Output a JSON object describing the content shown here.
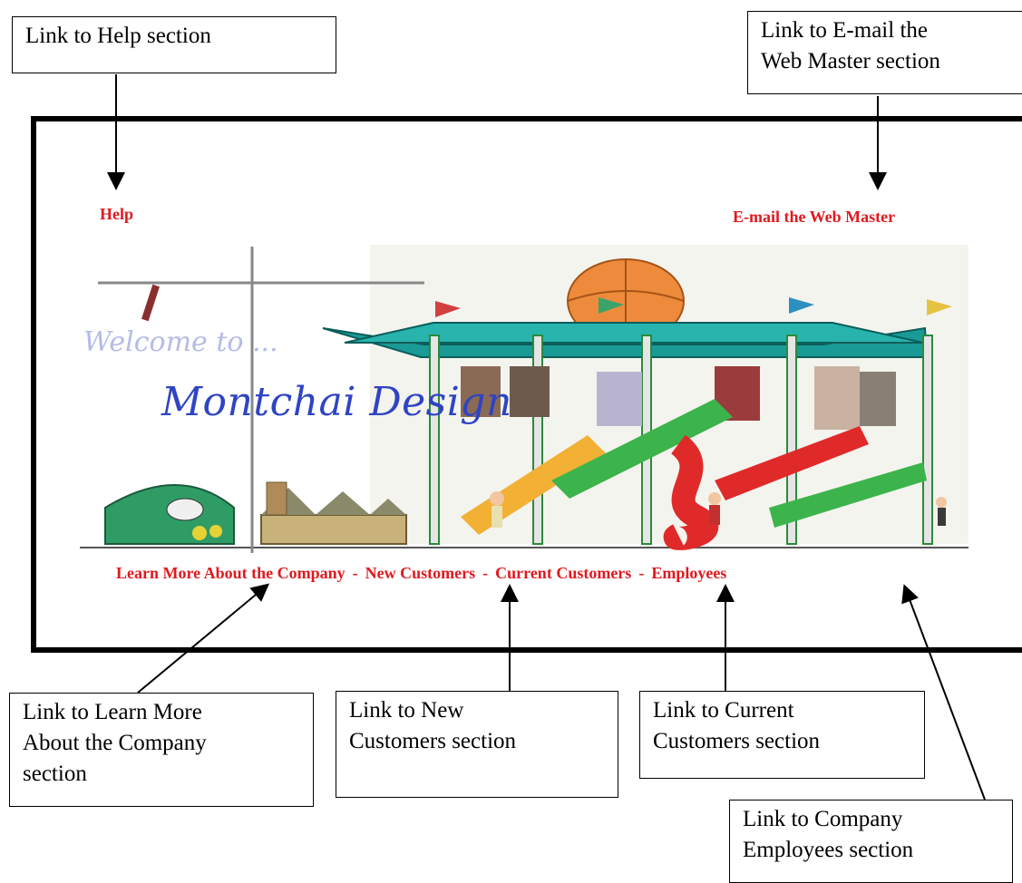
{
  "callouts": {
    "help": "Link to Help section",
    "email_line1": "Link to E-mail the",
    "email_line2": "Web Master section",
    "learn_line1": "Link to Learn More",
    "learn_line2": "About the Company",
    "learn_line3": "section",
    "new_line1": "Link to New",
    "new_line2": "Customers section",
    "current_line1": "Link to Current",
    "current_line2": "Customers section",
    "employees_line1": "Link to Company",
    "employees_line2": "Employees section"
  },
  "site": {
    "help_link": "Help",
    "email_link": "E-mail the Web Master",
    "welcome": "Welcome to ...",
    "brand": "Montchai Design",
    "nav": {
      "learn": "Learn More About the Company",
      "new_customers": "New Customers",
      "current_customers": "Current Customers",
      "employees": "Employees",
      "separator": "-"
    }
  },
  "colors": {
    "link_red": "#e0191f",
    "brand_blue": "#2f44c4",
    "welcome_blue": "#b4bce6"
  }
}
